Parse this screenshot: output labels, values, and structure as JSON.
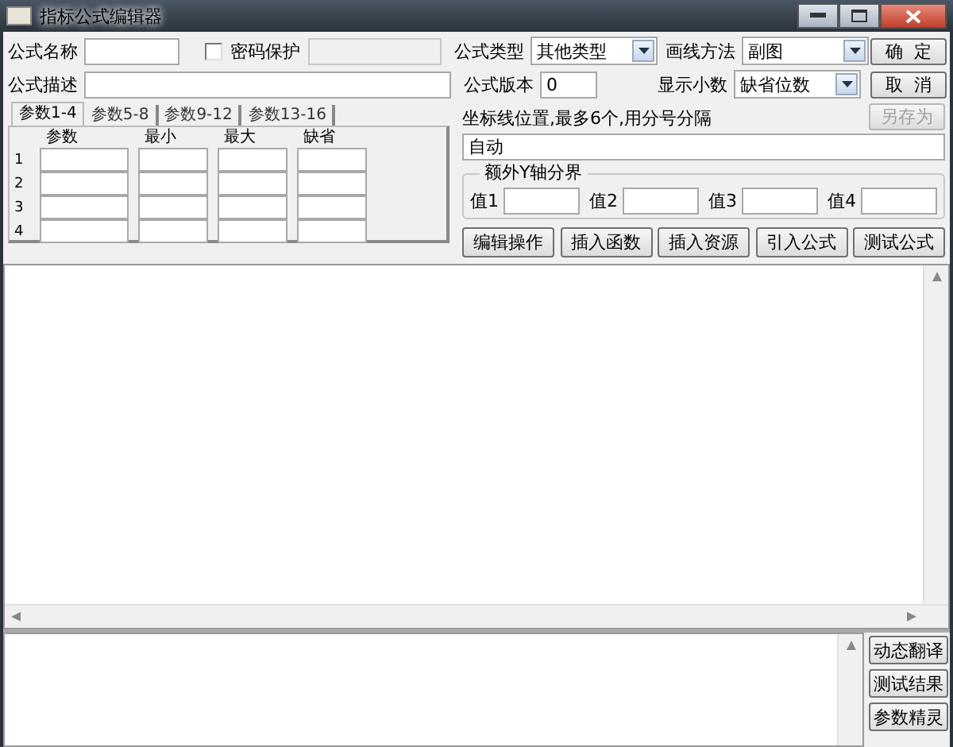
{
  "window": {
    "title": "指标公式编辑器"
  },
  "name_field": {
    "label": "公式名称"
  },
  "password": {
    "label": "密码保护",
    "checked": false
  },
  "description_field": {
    "label": "公式描述"
  },
  "formula_type": {
    "label": "公式类型",
    "value": "其他类型"
  },
  "draw_method": {
    "label": "画线方法",
    "value": "副图"
  },
  "version_field": {
    "label": "公式版本",
    "value": "0"
  },
  "decimals": {
    "label": "显示小数",
    "value": "缺省位数"
  },
  "dialog_buttons": [
    {
      "label": "确  定",
      "disabled": false
    },
    {
      "label": "取  消",
      "disabled": false
    },
    {
      "label": "另存为",
      "disabled": true
    }
  ],
  "tabs": [
    {
      "label": "参数1-4",
      "selected": true
    },
    {
      "label": "参数5-8",
      "selected": false
    },
    {
      "label": "参数9-12",
      "selected": false
    },
    {
      "label": "参数13-16",
      "selected": false
    }
  ],
  "params": {
    "columns": [
      "参数",
      "最小",
      "最大",
      "缺省"
    ],
    "rows": [
      "1",
      "2",
      "3",
      "4"
    ]
  },
  "axis_lines": {
    "label": "坐标线位置,最多6个,用分号分隔",
    "value": "自动"
  },
  "y_bounds": {
    "title": "额外Y轴分界",
    "fields": [
      {
        "label": "值1"
      },
      {
        "label": "值2"
      },
      {
        "label": "值3"
      },
      {
        "label": "值4"
      }
    ]
  },
  "action_buttons": [
    "编辑操作",
    "插入函数",
    "插入资源",
    "引入公式",
    "测试公式"
  ],
  "side_buttons": [
    "动态翻译",
    "测试结果",
    "参数精灵"
  ]
}
